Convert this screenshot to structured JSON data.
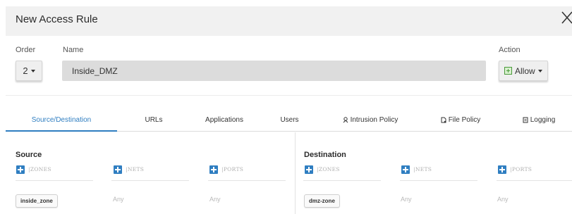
{
  "dialog": {
    "title": "New Access Rule"
  },
  "fields": {
    "order_label": "Order",
    "order_value": "2",
    "name_label": "Name",
    "name_value": "Inside_DMZ",
    "action_label": "Action",
    "action_value": "Allow"
  },
  "tabs": [
    {
      "label": "Source/Destination",
      "active": true
    },
    {
      "label": "URLs",
      "active": false
    },
    {
      "label": "Applications",
      "active": false
    },
    {
      "label": "Users",
      "active": false
    },
    {
      "label": "Intrusion Policy",
      "active": false
    },
    {
      "label": "File Policy",
      "active": false
    },
    {
      "label": "Logging",
      "active": false
    }
  ],
  "source": {
    "title": "Source",
    "zones_header": "ZONES",
    "nets_header": "NETS",
    "ports_header": "PORTS",
    "zone_value": "inside_zone",
    "nets_value": "Any",
    "ports_value": "Any"
  },
  "destination": {
    "title": "Destination",
    "zones_header": "ZONES",
    "nets_header": "NETS",
    "ports_header": "PORTS",
    "zone_value": "dmz-zone",
    "nets_value": "Any",
    "ports_value": "Any"
  },
  "colors": {
    "accent": "#2f7ec1",
    "header_bg": "#f1f1f1",
    "input_bg": "#dcdcdc",
    "allow_green": "#4a9a3a"
  }
}
